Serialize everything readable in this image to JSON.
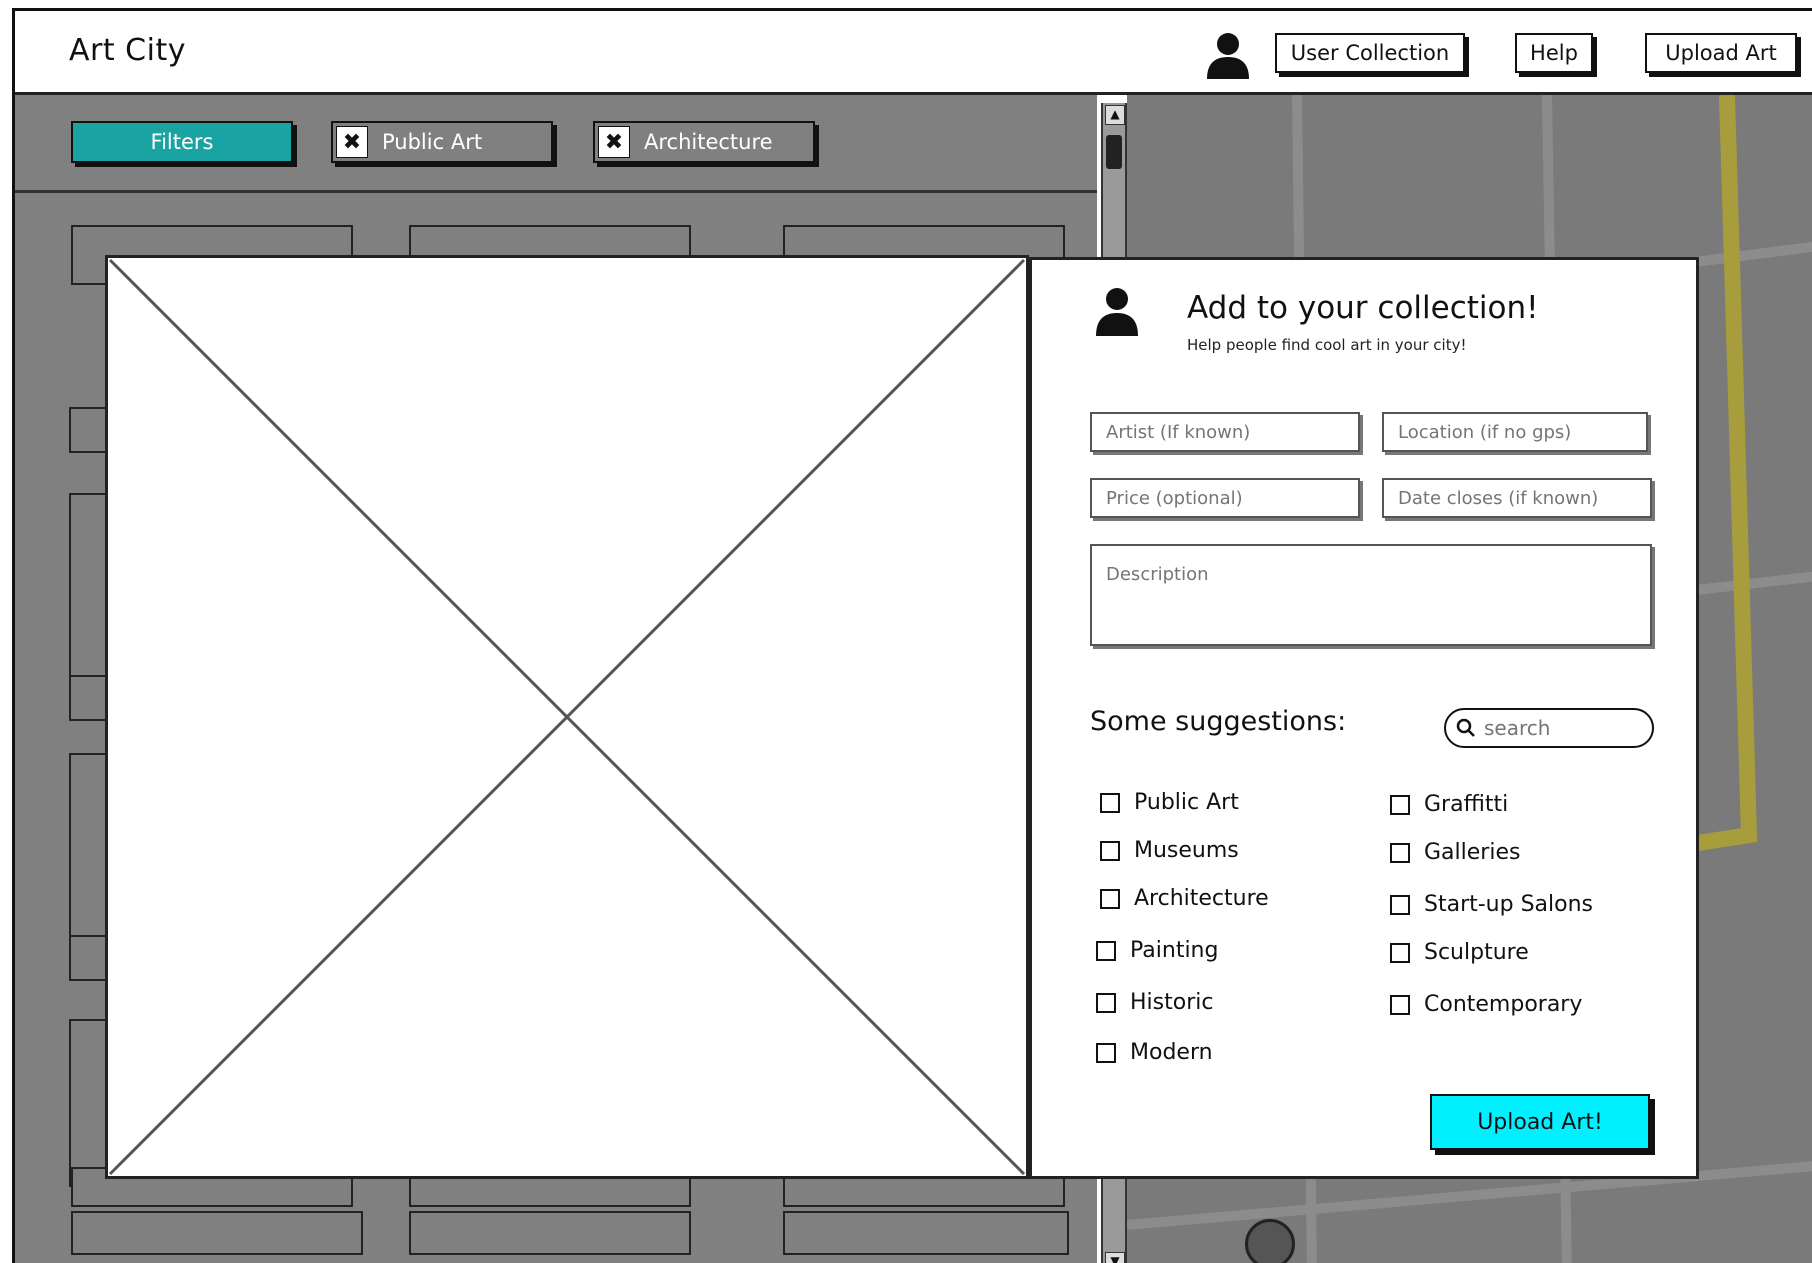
{
  "header": {
    "app_title": "Art City",
    "user_collection_label": "User Collection",
    "help_label": "Help",
    "upload_art_label": "Upload Art"
  },
  "filter_bar": {
    "filters_label": "Filters",
    "active_tags": [
      {
        "label": "Public Art"
      },
      {
        "label": "Architecture"
      }
    ],
    "remove_icon": "✖"
  },
  "form": {
    "title": "Add to your collection!",
    "subtitle": "Help people find cool art in your city!",
    "artist_placeholder": "Artist (If known)",
    "location_placeholder": "Location (if no gps)",
    "price_placeholder": "Price (optional)",
    "date_placeholder": "Date closes (if known)",
    "description_placeholder": "Description",
    "suggestions_title": "Some suggestions:",
    "search_placeholder": "search",
    "suggestions_left": [
      "Public Art",
      "Museums",
      "Architecture",
      "Painting",
      "Historic",
      "Modern"
    ],
    "suggestions_right": [
      "Graffitti",
      "Galleries",
      "Start-up Salons",
      "Sculpture",
      "Contemporary"
    ],
    "upload_button_label": "Upload Art!"
  },
  "colors": {
    "filters_button": "#1aa3a3",
    "upload_button": "#00f0ff",
    "panel_gray": "#808080",
    "map_gray": "#7a7a7a",
    "map_road_yellow": "#a89d3c"
  },
  "icons": [
    "user-icon",
    "remove-icon",
    "search-icon",
    "scroll-up-icon",
    "scroll-down-icon",
    "map-pin-icon"
  ]
}
